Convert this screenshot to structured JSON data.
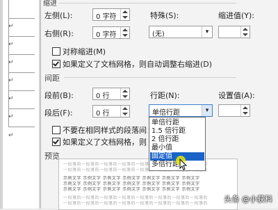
{
  "indent": {
    "section_title": "缩进",
    "left_label": "左侧(L):",
    "left_value": "0 字符",
    "right_label": "右侧(R):",
    "right_value": "0 字符",
    "special_label": "特殊(S):",
    "special_value": "(无)",
    "indent_by_label": "缩进值(Y):",
    "mirror_label": "对称缩进(M)",
    "mirror_checked": false,
    "auto_adjust_label": "如果定义了文档网格，则自动调整右缩进(D)",
    "auto_adjust_checked": true
  },
  "spacing": {
    "section_title": "间距",
    "before_label": "段前(B):",
    "before_value": "0 行",
    "after_label": "段后(F):",
    "after_value": "0 行",
    "line_spacing_label": "行距(N):",
    "line_spacing_value": "单倍行距",
    "at_label": "设置值(A):",
    "no_space_label": "不要在相同样式的段落间增加",
    "no_space_checked": false,
    "snap_grid_label": "如果定义了文档网格，则对齐",
    "snap_grid_checked": true
  },
  "line_spacing_options": [
    {
      "label": "单倍行距",
      "selected": false
    },
    {
      "label": "1.5 倍行距",
      "selected": false
    },
    {
      "label": "2 倍行距",
      "selected": false
    },
    {
      "label": "最小值",
      "selected": false
    },
    {
      "label": "固定值",
      "selected": true
    },
    {
      "label": "多倍行距",
      "selected": false
    }
  ],
  "preview": {
    "section_title": "预览",
    "prev_text": "一段落前一段落前一段落前一段落前一段落前一段落前一段落前一段落前",
    "sample_text": "示例文字 示例文字 示例文字 示例文字 示例文字 示例文字 示例文字",
    "next_text": "一段落后一段落后一段落后一段落后一段落后一段落后一段落后一段落后"
  },
  "watermark": "头条 @小获科",
  "colors": {
    "highlight": "#1a64c8",
    "cursor": "#f4f000"
  }
}
